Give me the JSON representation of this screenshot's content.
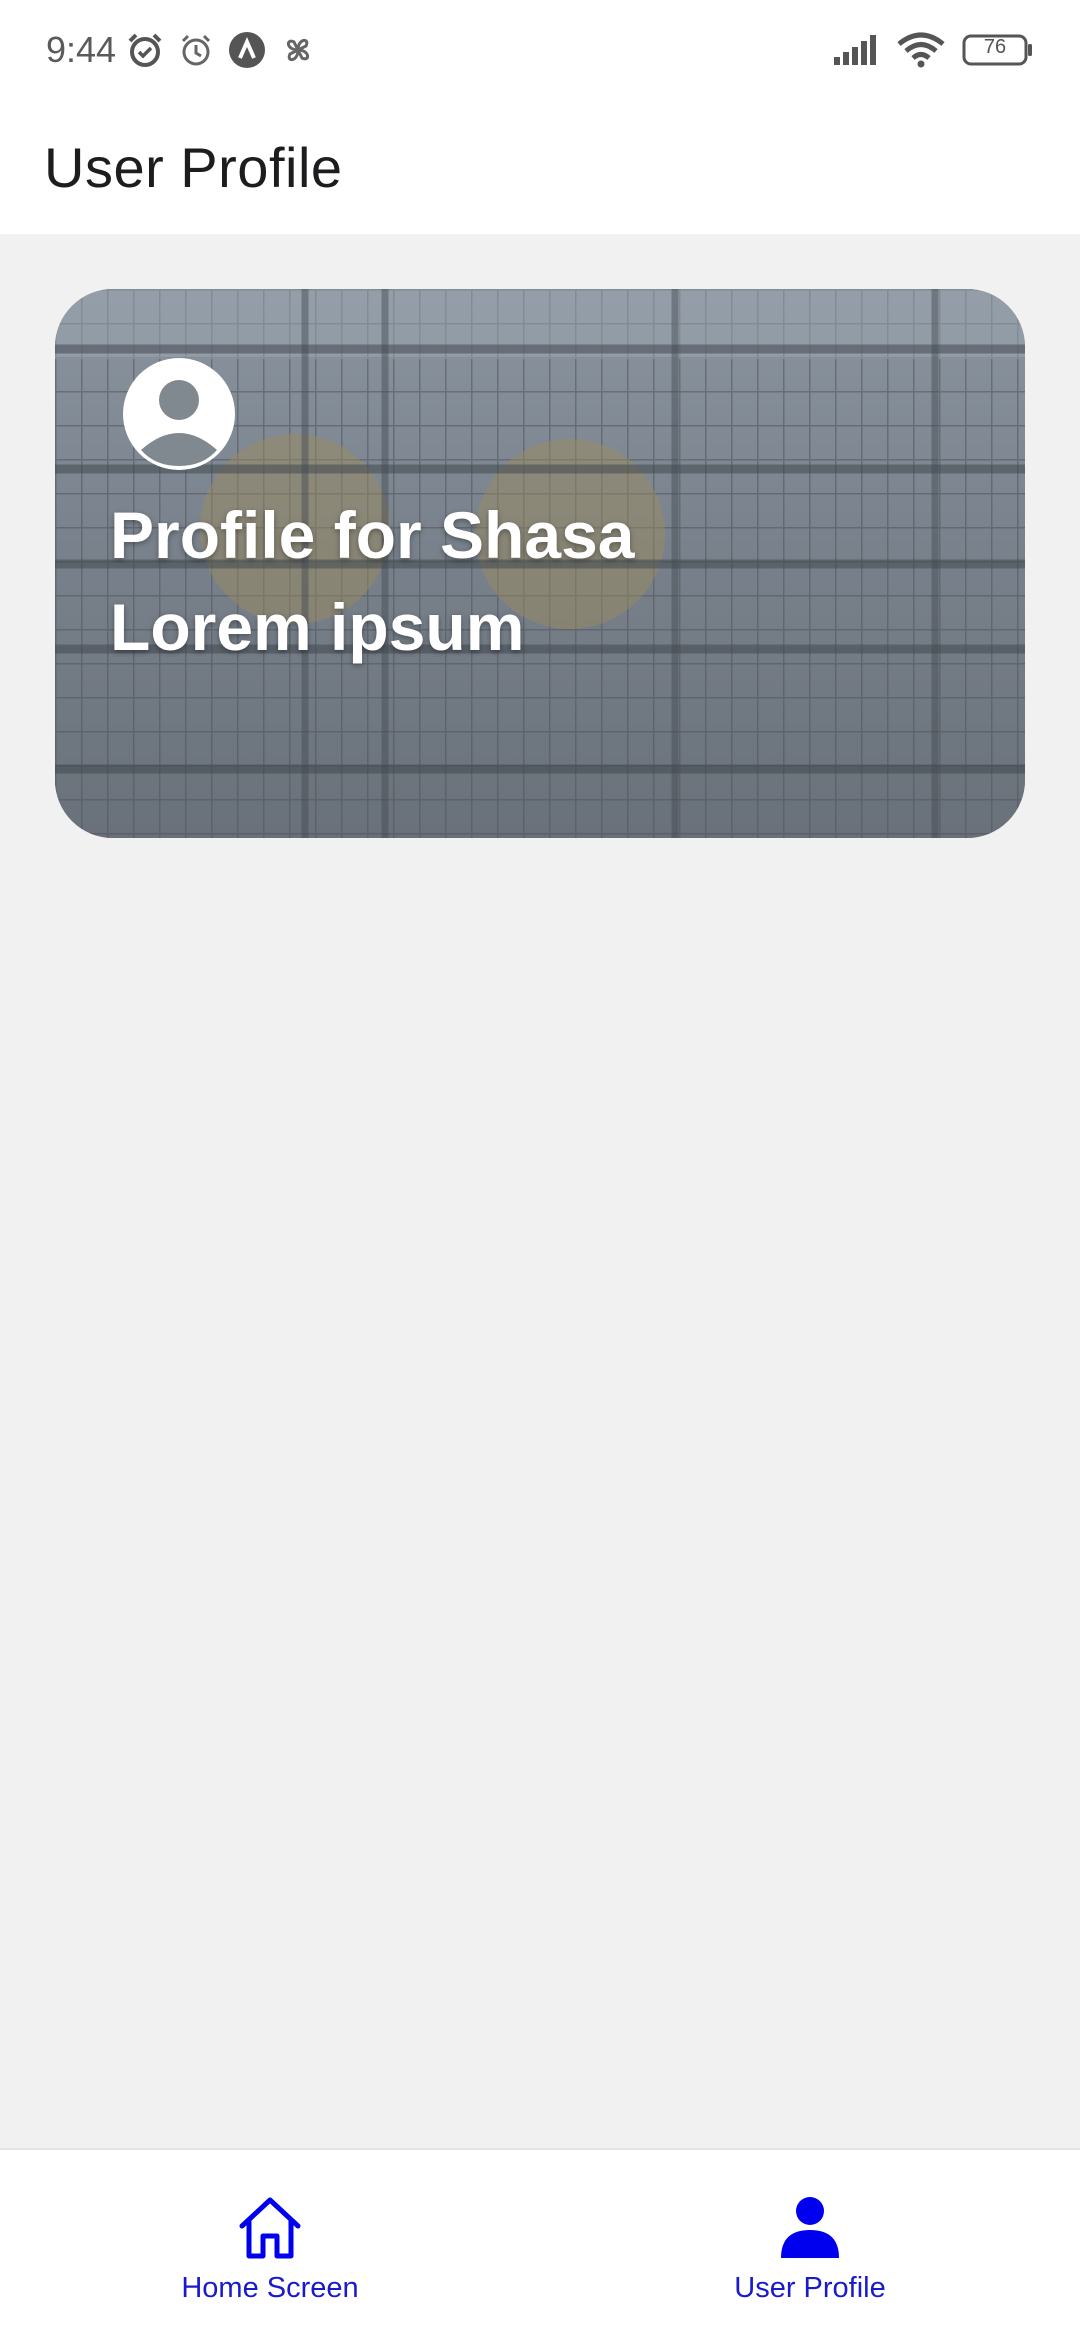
{
  "status_bar": {
    "time": "9:44",
    "battery": "76",
    "icons_left": [
      "alarm-check-icon",
      "alarm-icon",
      "app-a-icon",
      "pinwheel-icon"
    ],
    "icons_right": [
      "signal-icon",
      "wifi-icon",
      "battery-icon"
    ]
  },
  "app_bar": {
    "title": "User Profile"
  },
  "profile_card": {
    "title_line1": "Profile for Shasa",
    "title_line2": "Lorem ipsum",
    "avatar_icon": "person-icon",
    "background_image": "building-atrium-photo"
  },
  "bottom_nav": {
    "items": [
      {
        "label": "Home Screen",
        "icon": "home-icon",
        "active": false
      },
      {
        "label": "User Profile",
        "icon": "person-icon",
        "active": true
      }
    ]
  },
  "colors": {
    "accent": "#0000ee",
    "nav_text": "#1a1acc",
    "background": "#f1f1f2"
  }
}
